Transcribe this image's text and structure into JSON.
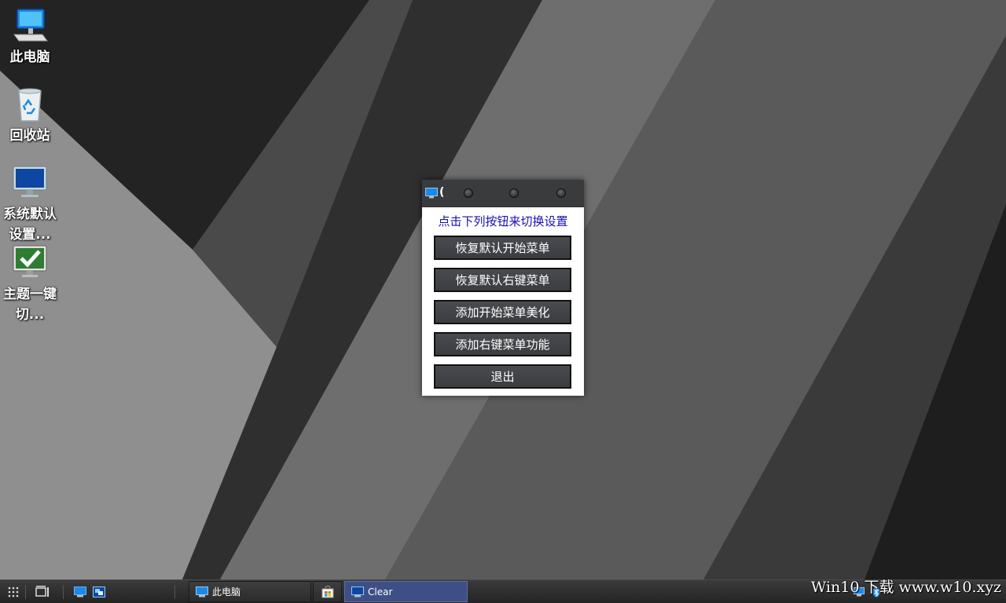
{
  "desktop": {
    "icons": [
      {
        "label": "此电脑"
      },
      {
        "label": "回收站"
      },
      {
        "label": "系统默认设置..."
      },
      {
        "label": "主题一键切..."
      }
    ]
  },
  "dialog": {
    "title_visible": "(",
    "heading": "点击下列按钮来切换设置",
    "buttons": [
      {
        "label": "恢复默认开始菜单"
      },
      {
        "label": "恢复默认右键菜单"
      },
      {
        "label": "添加开始菜单美化"
      },
      {
        "label": "添加右键菜单功能"
      },
      {
        "label": "退出"
      }
    ]
  },
  "taskbar": {
    "tasks": [
      {
        "label": "此电脑"
      },
      {
        "label": "Clear"
      }
    ],
    "active_color": "#3d4f84"
  },
  "watermark": "Win10 下载 www.w10.xyz",
  "colors": {
    "heading_text": "#1a0fb0",
    "dialog_titlebar": "#3a3b3d",
    "button_bg": "#434448"
  }
}
